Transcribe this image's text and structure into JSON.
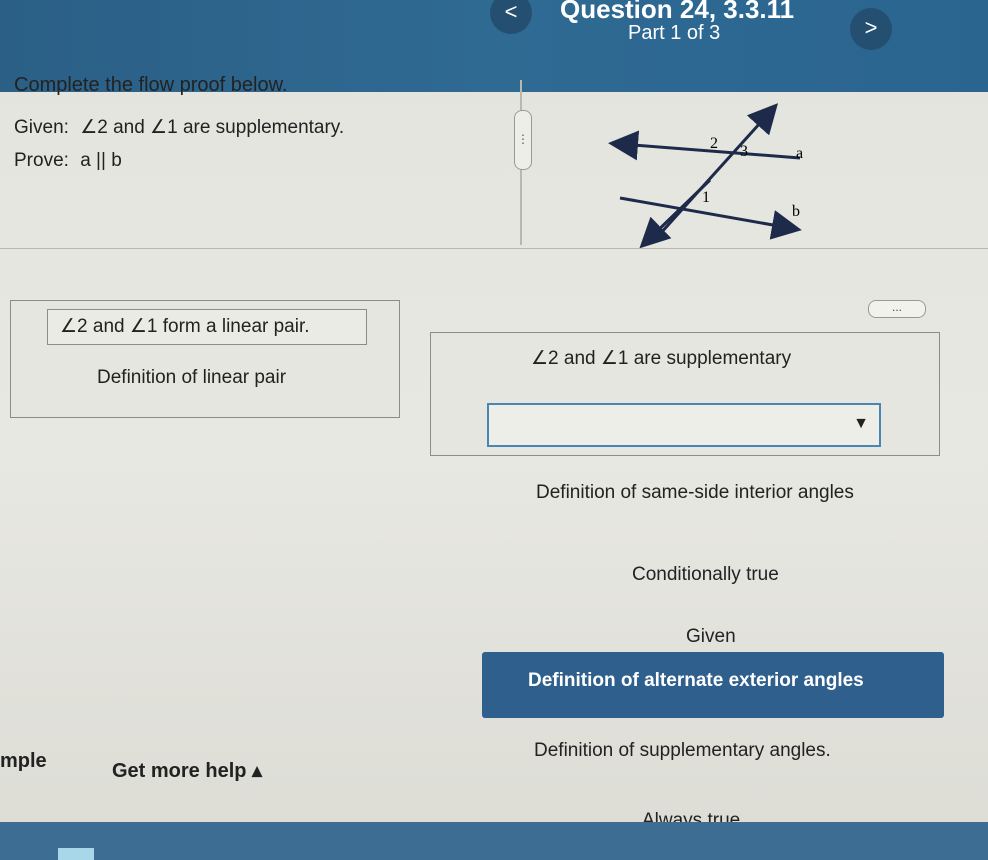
{
  "header": {
    "question_title": "Question 24, 3.3.11",
    "part_label": "Part 1 of 3",
    "prev_symbol": "<",
    "next_symbol": ">"
  },
  "problem": {
    "instruction": "Complete the flow proof below.",
    "given_label": "Given:",
    "given_text": "∠2 and ∠1 are supplementary.",
    "prove_label": "Prove:",
    "prove_text": "a || b"
  },
  "diagram": {
    "labels": {
      "angle2": "2",
      "angle3": "3",
      "angle1": "1",
      "line_a": "a",
      "line_b": "b"
    }
  },
  "controls": {
    "expand_handle": "⋮",
    "more_button": "..."
  },
  "proof": {
    "step1_statement": "∠2 and ∠1 form a linear pair.",
    "step1_reason": "Definition of linear pair",
    "step2_statement": "∠2 and ∠1 are supplementary",
    "dropdown_caret": "▼",
    "dropdown_options": [
      "Definition of same-side interior angles",
      "Conditionally true",
      "Given",
      "Definition of alternate exterior angles",
      "Definition of supplementary angles.",
      "Always true"
    ]
  },
  "footer": {
    "example_label": "mple",
    "help_label": "Get more help ▴"
  },
  "colors": {
    "header_bg": "#2b5f86",
    "selected_option_bg": "#2f5f8c",
    "dropdown_border": "#4a86b4"
  }
}
